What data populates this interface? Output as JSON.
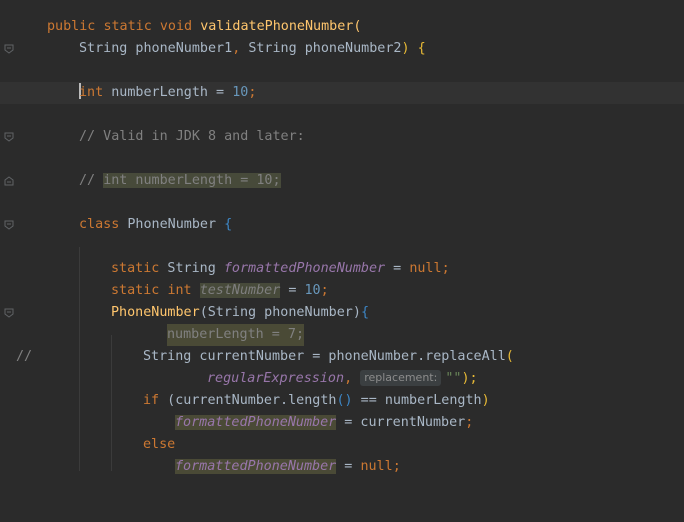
{
  "code": {
    "l1": {
      "kw1": "public",
      "kw2": "static",
      "kw3": "void",
      "fn": "validatePhoneNumber",
      "p": "("
    },
    "l2": {
      "t1": "String phoneNumber1",
      "c": ", ",
      "t2": "String phoneNumber2",
      "p": ") {"
    },
    "l3": {
      "kw": "int",
      "t": " numberLength = ",
      "num": "10",
      "semi": ";"
    },
    "l4": {
      "cmt": "// Valid in JDK 8 and later:"
    },
    "l5": {
      "cmt1": "// ",
      "cmt2": "int numberLength = 10;"
    },
    "l6": {
      "kw": "class",
      "t": " PhoneNumber ",
      "p": "{"
    },
    "l7": {
      "kw": "static",
      "t1": " String ",
      "f": "formattedPhoneNumber",
      "t2": " = ",
      "kw2": "null",
      "semi": ";"
    },
    "l8": {
      "kw": "static",
      "kw2": "int",
      "t1": " ",
      "f": "testNumber",
      "t2": " = ",
      "num": "10",
      "semi": ";"
    },
    "l9": {
      "fn": "PhoneNumber",
      "t": "(String phoneNumber)",
      "p": "{"
    },
    "l10": {
      "slashes": "//",
      "t": "numberLength = 7;"
    },
    "l11": {
      "t": "String currentNumber = phoneNumber.replaceAll",
      "p": "("
    },
    "l12": {
      "f": "regularExpression",
      "c": ", ",
      "hint": "replacement:",
      "s": "\"\"",
      "p": ");"
    },
    "l13": {
      "kw": "if",
      "t": " (currentNumber.length",
      "p1": "()",
      "t2": " == numberLength",
      "p2": ")"
    },
    "l14": {
      "f": "formattedPhoneNumber",
      "t": " = currentNumber",
      "semi": ";"
    },
    "l15": {
      "kw": "else"
    },
    "l16": {
      "f": "formattedPhoneNumber",
      "t": " = ",
      "kw": "null",
      "semi": ";"
    }
  },
  "icons": [
    "lightbulb-icon",
    "fold-icon"
  ],
  "colors": {
    "background": "#2b2b2b",
    "keyword": "#cc7832",
    "function": "#ffc66d",
    "number": "#6897bb",
    "comment": "#808080",
    "field": "#9876aa"
  }
}
